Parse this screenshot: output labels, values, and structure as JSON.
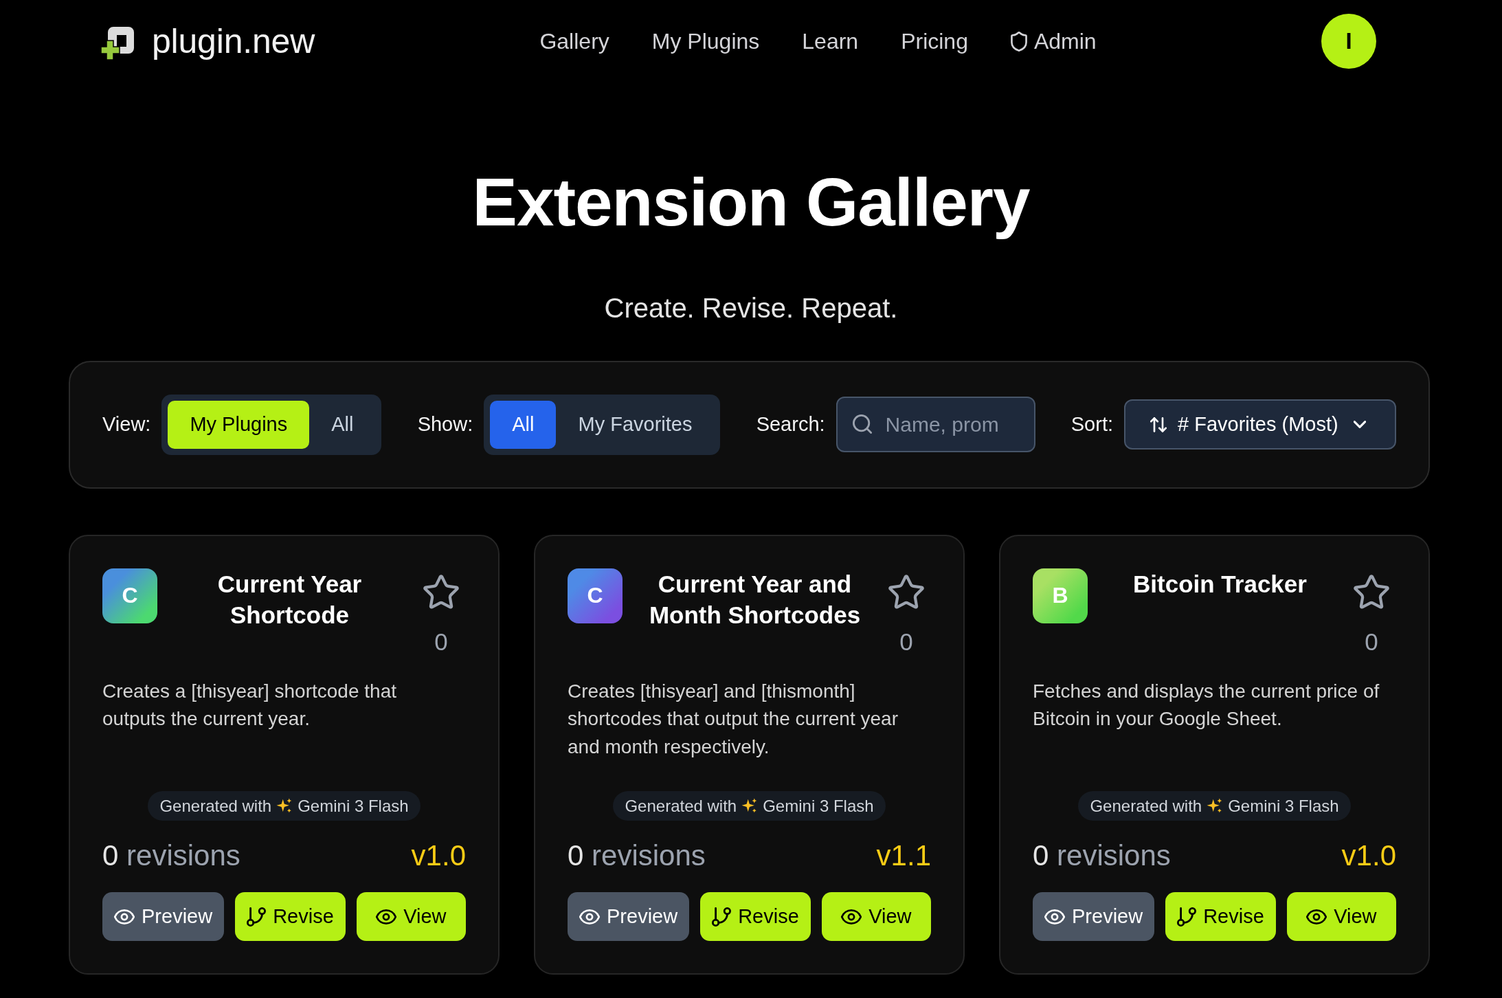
{
  "header": {
    "logo": "plugin.new",
    "nav": [
      {
        "label": "Gallery",
        "kind": "link"
      },
      {
        "label": "My Plugins",
        "kind": "link"
      },
      {
        "label": "Learn",
        "kind": "link"
      },
      {
        "label": "Pricing",
        "kind": "link"
      },
      {
        "label": "Admin",
        "kind": "admin"
      }
    ],
    "avatar": "I"
  },
  "hero": {
    "title": "Extension Gallery",
    "subtitle": "Create. Revise. Repeat."
  },
  "filters": [
    {
      "kind": "segmented",
      "label": "View:",
      "color": "#b5f015",
      "options": [
        {
          "label": "My Plugins",
          "selected": true
        },
        {
          "label": "All",
          "selected": false
        }
      ]
    },
    {
      "kind": "segmented",
      "label": "Show:",
      "color": "#2563eb",
      "options": [
        {
          "label": "All",
          "selected": true
        },
        {
          "label": "My Favorites",
          "selected": false
        }
      ]
    },
    {
      "kind": "search",
      "label": "Search:",
      "placeholder": "Name, prom"
    },
    {
      "kind": "sort",
      "label": "Sort:",
      "value": "# Favorites (Most)"
    }
  ],
  "cards": [
    {
      "icon": {
        "letter": "C",
        "gradient": [
          {
            "color": "#4a8fdc"
          },
          {
            "color": "#4cd970"
          }
        ]
      },
      "title": "Current Year Shortcode",
      "favorited": false,
      "favorites": "0",
      "description": "Creates a [thisyear] shortcode that outputs the current year.",
      "badge": {
        "prefix": "Generated with",
        "model": "Gemini 3 Flash"
      },
      "revisions": {
        "count": "0",
        "label": "revisions"
      },
      "version": "v1.0",
      "buttons": [
        {
          "label": "Preview",
          "kind": "preview"
        },
        {
          "label": "Revise",
          "kind": "revise"
        },
        {
          "label": "View",
          "kind": "view"
        }
      ]
    },
    {
      "icon": {
        "letter": "C",
        "gradient": [
          {
            "color": "#4f8ae6"
          },
          {
            "color": "#7b4fe0"
          }
        ]
      },
      "title": "Current Year and Month Shortcodes",
      "favorited": false,
      "favorites": "0",
      "description": "Creates [thisyear] and [thismonth] shortcodes that output the current year and month respectively.",
      "badge": {
        "prefix": "Generated with",
        "model": "Gemini 3 Flash"
      },
      "revisions": {
        "count": "0",
        "label": "revisions"
      },
      "version": "v1.1",
      "buttons": [
        {
          "label": "Preview",
          "kind": "preview"
        },
        {
          "label": "Revise",
          "kind": "revise"
        },
        {
          "label": "View",
          "kind": "view"
        }
      ]
    },
    {
      "icon": {
        "letter": "B",
        "gradient": [
          {
            "color": "#a8e063"
          },
          {
            "color": "#52d94a"
          }
        ]
      },
      "title": "Bitcoin Tracker",
      "favorited": false,
      "favorites": "0",
      "description": "Fetches and displays the current price of Bitcoin in your Google Sheet.",
      "badge": {
        "prefix": "Generated with",
        "model": "Gemini 3 Flash"
      },
      "revisions": {
        "count": "0",
        "label": "revisions"
      },
      "version": "v1.0",
      "buttons": [
        {
          "label": "Preview",
          "kind": "preview"
        },
        {
          "label": "Revise",
          "kind": "revise"
        },
        {
          "label": "View",
          "kind": "view"
        }
      ]
    }
  ]
}
